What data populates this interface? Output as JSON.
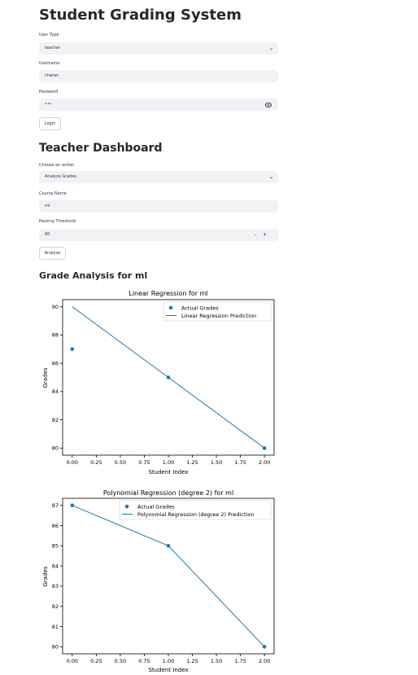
{
  "app": {
    "title": "Student Grading System"
  },
  "login": {
    "user_type_label": "User Type",
    "user_type_value": "teacher",
    "username_label": "Username",
    "username_value": "charan",
    "password_label": "Password",
    "password_value": "•••",
    "login_button": "Login"
  },
  "dashboard": {
    "title": "Teacher Dashboard",
    "action_label": "Choose an action",
    "action_value": "Analyze Grades",
    "course_label": "Course Name",
    "course_value": "ml",
    "threshold_label": "Passing Threshold",
    "threshold_value": "60",
    "analyze_button": "Analyze"
  },
  "analysis": {
    "title": "Grade Analysis for ml"
  },
  "icons": {
    "select": "chevron-down-icon",
    "password": "eye-icon",
    "stepper": "minus-plus-icon"
  },
  "colors": {
    "series": "#1f77b4",
    "accent_bg": "#f0f2f6"
  },
  "chart_data": [
    {
      "type": "scatter+line",
      "title": "Linear Regression for ml",
      "xlabel": "Student Index",
      "ylabel": "Grades",
      "x_ticks": [
        "0.00",
        "0.25",
        "0.50",
        "0.75",
        "1.00",
        "1.25",
        "1.50",
        "1.75",
        "2.00"
      ],
      "y_ticks": [
        "80",
        "82",
        "84",
        "86",
        "88",
        "90"
      ],
      "xlim": [
        -0.1,
        2.1
      ],
      "ylim": [
        79.5,
        90.5
      ],
      "series": [
        {
          "name": "Actual Grades",
          "kind": "scatter",
          "x": [
            0,
            1,
            2
          ],
          "y": [
            87,
            85,
            80
          ]
        },
        {
          "name": "Linear Regression Prediction",
          "kind": "line",
          "x": [
            0,
            1,
            2
          ],
          "y": [
            90,
            85,
            80
          ]
        }
      ],
      "legend": "top-right"
    },
    {
      "type": "scatter+line",
      "title": "Polynomial Regression (degree 2) for ml",
      "xlabel": "Student Index",
      "ylabel": "Grades",
      "x_ticks": [
        "0.00",
        "0.25",
        "0.50",
        "0.75",
        "1.00",
        "1.25",
        "1.50",
        "1.75",
        "2.00"
      ],
      "y_ticks": [
        "80",
        "81",
        "82",
        "83",
        "84",
        "85",
        "86",
        "87"
      ],
      "xlim": [
        -0.1,
        2.1
      ],
      "ylim": [
        79.65,
        87.35
      ],
      "series": [
        {
          "name": "Actual Grades",
          "kind": "scatter",
          "x": [
            0,
            1,
            2
          ],
          "y": [
            87,
            85,
            80
          ]
        },
        {
          "name": "Polynomial Regression (degree 2) Prediction",
          "kind": "line",
          "x": [
            0,
            1,
            2
          ],
          "y": [
            87,
            85,
            80
          ]
        }
      ],
      "legend": "top-right"
    }
  ]
}
